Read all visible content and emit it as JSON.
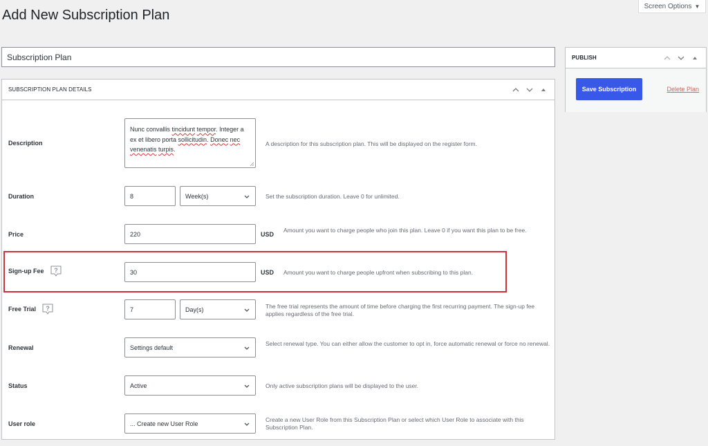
{
  "page": {
    "title": "Add New Subscription Plan",
    "screen_options_label": "Screen Options"
  },
  "title_field": {
    "value": "Subscription Plan"
  },
  "details_box": {
    "heading": "Subscription Plan Details",
    "fields": {
      "description": {
        "label": "Description",
        "value_parts": [
          "Nunc convallis ",
          "tincidunt",
          " ",
          "tempor",
          ". Integer a ex et libero porta ",
          "sollicitudin",
          ". ",
          "Donec",
          " ",
          "nec",
          " ",
          "venenatis",
          " ",
          "turpis",
          "."
        ],
        "help": "A description for this subscription plan. This will be displayed on the register form."
      },
      "duration": {
        "label": "Duration",
        "value": "8",
        "unit": "Week(s)",
        "help": "Set the subscription duration. Leave 0 for unlimited."
      },
      "price": {
        "label": "Price",
        "value": "220",
        "currency": "USD",
        "help": "Amount you want to charge people who join this plan. Leave 0 if you want this plan to be free."
      },
      "signup_fee": {
        "label": "Sign-up Fee",
        "value": "30",
        "currency": "USD",
        "help": "Amount you want to charge people upfront when subscribing to this plan."
      },
      "free_trial": {
        "label": "Free Trial",
        "value": "7",
        "unit": "Day(s)",
        "help": "The free trial represents the amount of time before charging the first recurring payment. The sign-up fee applies regardless of the free trial."
      },
      "renewal": {
        "label": "Renewal",
        "value": "Settings default",
        "help": "Select renewal type. You can either allow the customer to opt in, force automatic renewal or force no renewal."
      },
      "status": {
        "label": "Status",
        "value": "Active",
        "help": "Only active subscription plans will be displayed to the user."
      },
      "user_role": {
        "label": "User role",
        "value": "... Create new User Role",
        "help": "Create a new User Role from this Subscription Plan or select which User Role to associate with this Subscription Plan."
      }
    }
  },
  "publish_box": {
    "heading": "Publish",
    "save_label": "Save Subscription",
    "delete_label": "Delete Plan"
  },
  "colors": {
    "primary": "#3858e9",
    "delete": "#e35b5b",
    "highlight": "#d32f3a"
  }
}
